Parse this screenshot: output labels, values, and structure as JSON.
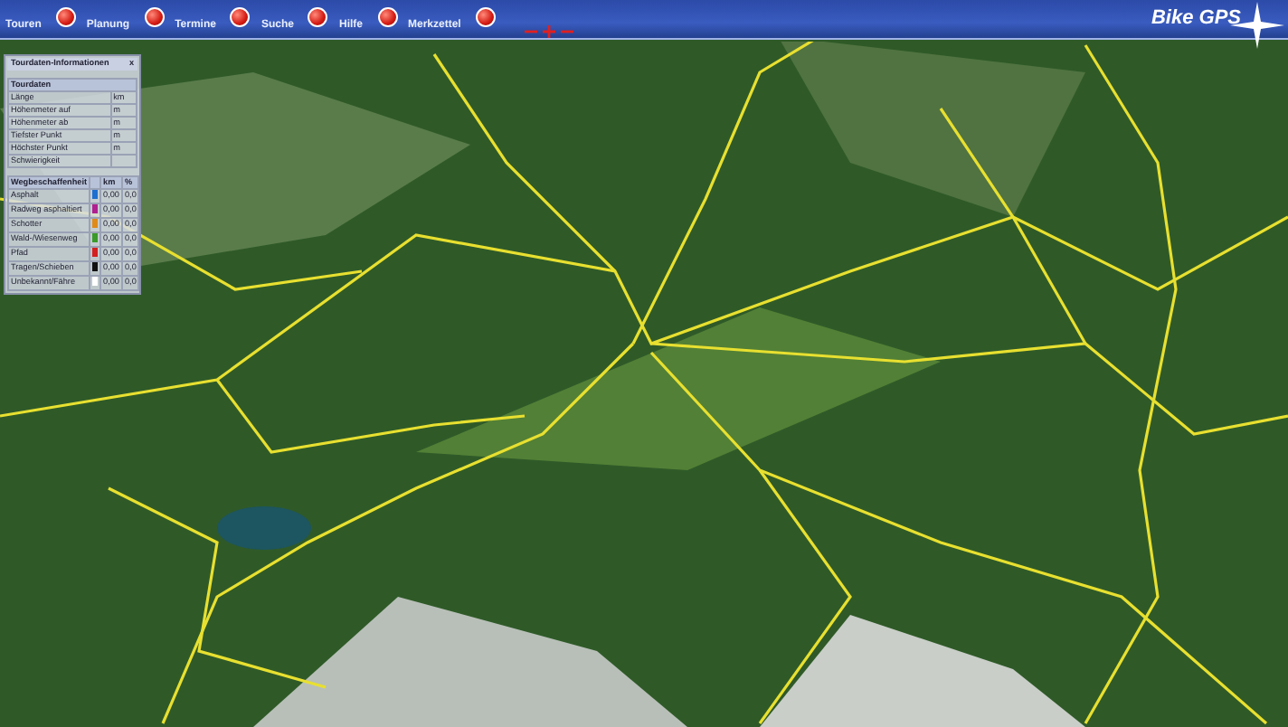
{
  "toolbar": {
    "items": [
      {
        "label": "Touren"
      },
      {
        "label": "Planung"
      },
      {
        "label": "Termine"
      },
      {
        "label": "Suche"
      },
      {
        "label": "Hilfe"
      },
      {
        "label": "Merkzettel"
      }
    ],
    "logo": "Bike GPS"
  },
  "info_panel": {
    "title": "Tourdaten-Informationen",
    "close": "x",
    "tour_header": "Tourdaten",
    "tour_rows": [
      {
        "label": "Länge",
        "unit": "km"
      },
      {
        "label": "Höhenmeter auf",
        "unit": "m"
      },
      {
        "label": "Höhenmeter ab",
        "unit": "m"
      },
      {
        "label": "Tiefster Punkt",
        "unit": "m"
      },
      {
        "label": "Höchster Punkt",
        "unit": "m"
      },
      {
        "label": "Schwierigkeit",
        "unit": ""
      }
    ],
    "surface_header": {
      "label": "Wegbeschaffenheit",
      "col_km": "km",
      "col_pct": "%"
    },
    "surface_rows": [
      {
        "label": "Asphalt",
        "color": "#1f6fd0",
        "km": "0,00",
        "pct": "0,0"
      },
      {
        "label": "Radweg asphaltiert",
        "color": "#b0208f",
        "km": "0,00",
        "pct": "0,0"
      },
      {
        "label": "Schotter",
        "color": "#e08a1a",
        "km": "0,00",
        "pct": "0,0"
      },
      {
        "label": "Wald-/Wiesenweg",
        "color": "#3a9a2a",
        "km": "0,00",
        "pct": "0,0"
      },
      {
        "label": "Pfad",
        "color": "#d42020",
        "km": "0,00",
        "pct": "0,0"
      },
      {
        "label": "Tragen/Schieben",
        "color": "#111111",
        "km": "0,00",
        "pct": "0,0"
      },
      {
        "label": "Unbekannt/Fähre",
        "color": "#ffffff",
        "km": "0,00",
        "pct": "0,0"
      }
    ]
  }
}
